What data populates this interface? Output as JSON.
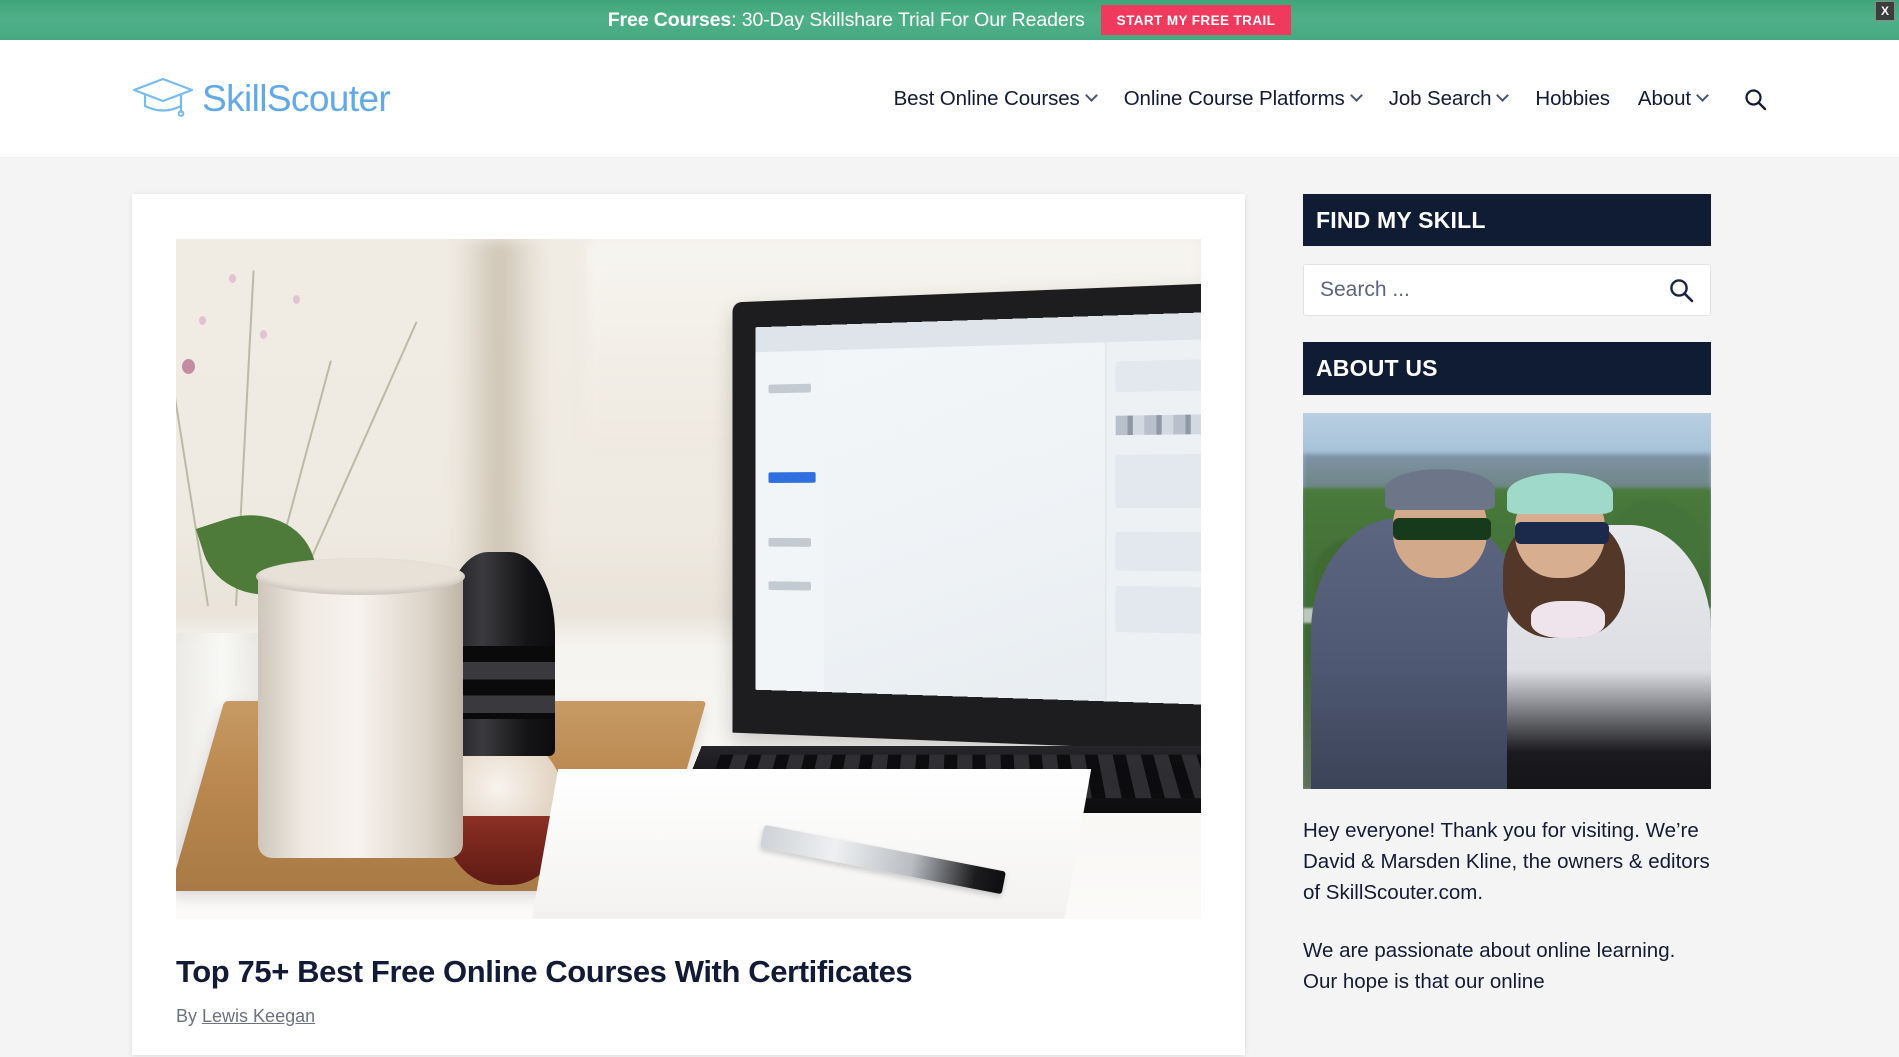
{
  "promo": {
    "lead": "Free Courses",
    "rest": ": 30-Day Skillshare Trial For Our Readers",
    "cta_label": "START MY FREE TRAIL",
    "close_label": "X",
    "bg_color": "#4fb088",
    "cta_color": "#ef3a5d"
  },
  "header": {
    "brand_name": "SkillScouter",
    "brand_color": "#62a9e8",
    "nav": [
      {
        "label": "Best Online Courses",
        "has_dropdown": true
      },
      {
        "label": "Online Course Platforms",
        "has_dropdown": true
      },
      {
        "label": "Job Search",
        "has_dropdown": true
      },
      {
        "label": "Hobbies",
        "has_dropdown": false
      },
      {
        "label": "About",
        "has_dropdown": true
      }
    ],
    "search_icon": "search-icon"
  },
  "article": {
    "thumbnail_alt": "Laptop on white desk with mug on wooden tray, flowers and pen",
    "title": "Top 75+ Best Free Online Courses With Certificates",
    "byline_prefix": "By",
    "author": "Lewis Keegan"
  },
  "sidebar": {
    "find_my_skill": {
      "heading": "FIND MY SKILL",
      "search_placeholder": "Search ...",
      "search_value": "",
      "submit_icon": "search-icon"
    },
    "about_us": {
      "heading": "ABOUT US",
      "photo_alt": "David and Marsden Kline outdoors wearing caps and sunglasses",
      "paragraphs": [
        "Hey everyone! Thank you for visiting. We’re David & Marsden Kline, the owners & editors of SkillScouter.com.",
        "We are passionate about online learning. Our hope is that our online"
      ]
    },
    "accent_color": "#101c34"
  }
}
